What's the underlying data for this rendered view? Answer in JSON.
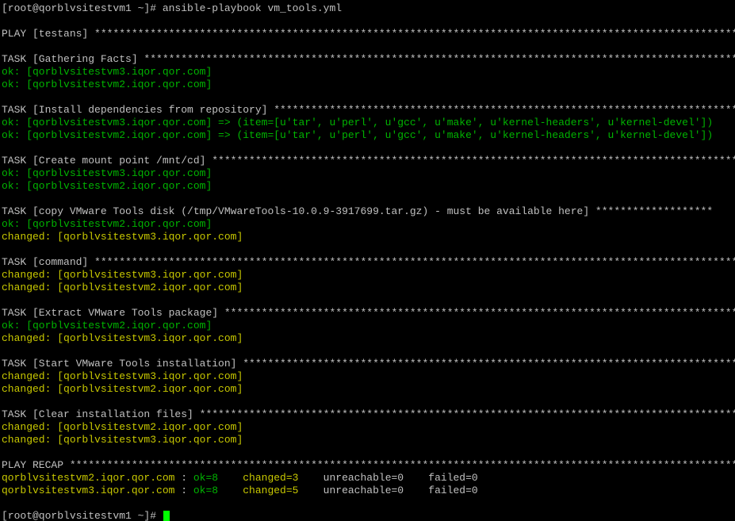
{
  "terminal": {
    "colors": {
      "background": "#000000",
      "default": "#c0c0c0",
      "ok": "#00b400",
      "changed": "#c8c800",
      "cursor": "#00ff00"
    },
    "lines": [
      {
        "segments": [
          {
            "text": "[root@qorblvsitestvm1 ~]# ansible-playbook vm_tools.yml",
            "color": "default"
          }
        ]
      },
      {
        "segments": [
          {
            "text": "PLAY [testans] *********************************************************************************************************************",
            "color": "default"
          }
        ]
      },
      {
        "segments": [
          {
            "text": "TASK [Gathering Facts] *************************************************************************************************************",
            "color": "default"
          }
        ]
      },
      {
        "segments": [
          {
            "text": "ok: [qorblvsitestvm3.iqor.qor.com]",
            "color": "ok"
          }
        ]
      },
      {
        "segments": [
          {
            "text": "ok: [qorblvsitestvm2.iqor.qor.com]",
            "color": "ok"
          }
        ]
      },
      {
        "segments": [
          {
            "text": "TASK [Install dependencies from repository] ************************************************************************************",
            "color": "default"
          }
        ]
      },
      {
        "segments": [
          {
            "text": "ok: [qorblvsitestvm3.iqor.qor.com] => (item=[u'tar', u'perl', u'gcc', u'make', u'kernel-headers', u'kernel-devel'])",
            "color": "ok"
          }
        ]
      },
      {
        "segments": [
          {
            "text": "ok: [qorblvsitestvm2.iqor.qor.com] => (item=[u'tar', u'perl', u'gcc', u'make', u'kernel-headers', u'kernel-devel'])",
            "color": "ok"
          }
        ]
      },
      {
        "segments": [
          {
            "text": "TASK [Create mount point /mnt/cd] **********************************************************************************************",
            "color": "default"
          }
        ]
      },
      {
        "segments": [
          {
            "text": "ok: [qorblvsitestvm3.iqor.qor.com]",
            "color": "ok"
          }
        ]
      },
      {
        "segments": [
          {
            "text": "ok: [qorblvsitestvm2.iqor.qor.com]",
            "color": "ok"
          }
        ]
      },
      {
        "segments": [
          {
            "text": "TASK [copy VMware Tools disk (/tmp/VMwareTools-10.0.9-3917699.tar.gz) - must be available here] *******************",
            "color": "default"
          }
        ]
      },
      {
        "segments": [
          {
            "text": "ok: [qorblvsitestvm2.iqor.qor.com]",
            "color": "ok"
          }
        ]
      },
      {
        "segments": [
          {
            "text": "changed: [qorblvsitestvm3.iqor.qor.com]",
            "color": "changed"
          }
        ]
      },
      {
        "segments": [
          {
            "text": "TASK [command] *********************************************************************************************************************",
            "color": "default"
          }
        ]
      },
      {
        "segments": [
          {
            "text": "changed: [qorblvsitestvm3.iqor.qor.com]",
            "color": "changed"
          }
        ]
      },
      {
        "segments": [
          {
            "text": "changed: [qorblvsitestvm2.iqor.qor.com]",
            "color": "changed"
          }
        ]
      },
      {
        "segments": [
          {
            "text": "TASK [Extract VMware Tools package] ********************************************************************************************",
            "color": "default"
          }
        ]
      },
      {
        "segments": [
          {
            "text": "ok: [qorblvsitestvm2.iqor.qor.com]",
            "color": "ok"
          }
        ]
      },
      {
        "segments": [
          {
            "text": "changed: [qorblvsitestvm3.iqor.qor.com]",
            "color": "changed"
          }
        ]
      },
      {
        "segments": [
          {
            "text": "TASK [Start VMware Tools installation] *****************************************************************************************",
            "color": "default"
          }
        ]
      },
      {
        "segments": [
          {
            "text": "changed: [qorblvsitestvm3.iqor.qor.com]",
            "color": "changed"
          }
        ]
      },
      {
        "segments": [
          {
            "text": "changed: [qorblvsitestvm2.iqor.qor.com]",
            "color": "changed"
          }
        ]
      },
      {
        "segments": [
          {
            "text": "TASK [Clear installation files] ************************************************************************************************",
            "color": "default"
          }
        ]
      },
      {
        "segments": [
          {
            "text": "changed: [qorblvsitestvm2.iqor.qor.com]",
            "color": "changed"
          }
        ]
      },
      {
        "segments": [
          {
            "text": "changed: [qorblvsitestvm3.iqor.qor.com]",
            "color": "changed"
          }
        ]
      },
      {
        "segments": [
          {
            "text": "PLAY RECAP *************************************************************************************************************************",
            "color": "default"
          }
        ]
      },
      {
        "segments": [
          {
            "text": "qorblvsitestvm2.iqor.qor.com",
            "color": "changed"
          },
          {
            "text": " : ",
            "color": "default"
          },
          {
            "text": "ok=8   ",
            "color": "ok"
          },
          {
            "text": " changed=3   ",
            "color": "changed"
          },
          {
            "text": " unreachable=0    failed=0",
            "color": "default"
          }
        ]
      },
      {
        "segments": [
          {
            "text": "qorblvsitestvm3.iqor.qor.com",
            "color": "changed"
          },
          {
            "text": " : ",
            "color": "default"
          },
          {
            "text": "ok=8   ",
            "color": "ok"
          },
          {
            "text": " changed=5   ",
            "color": "changed"
          },
          {
            "text": " unreachable=0    failed=0",
            "color": "default"
          }
        ]
      },
      {
        "segments": [
          {
            "text": "[root@qorblvsitestvm1 ~]# ",
            "color": "default"
          }
        ],
        "cursor": true
      }
    ]
  }
}
